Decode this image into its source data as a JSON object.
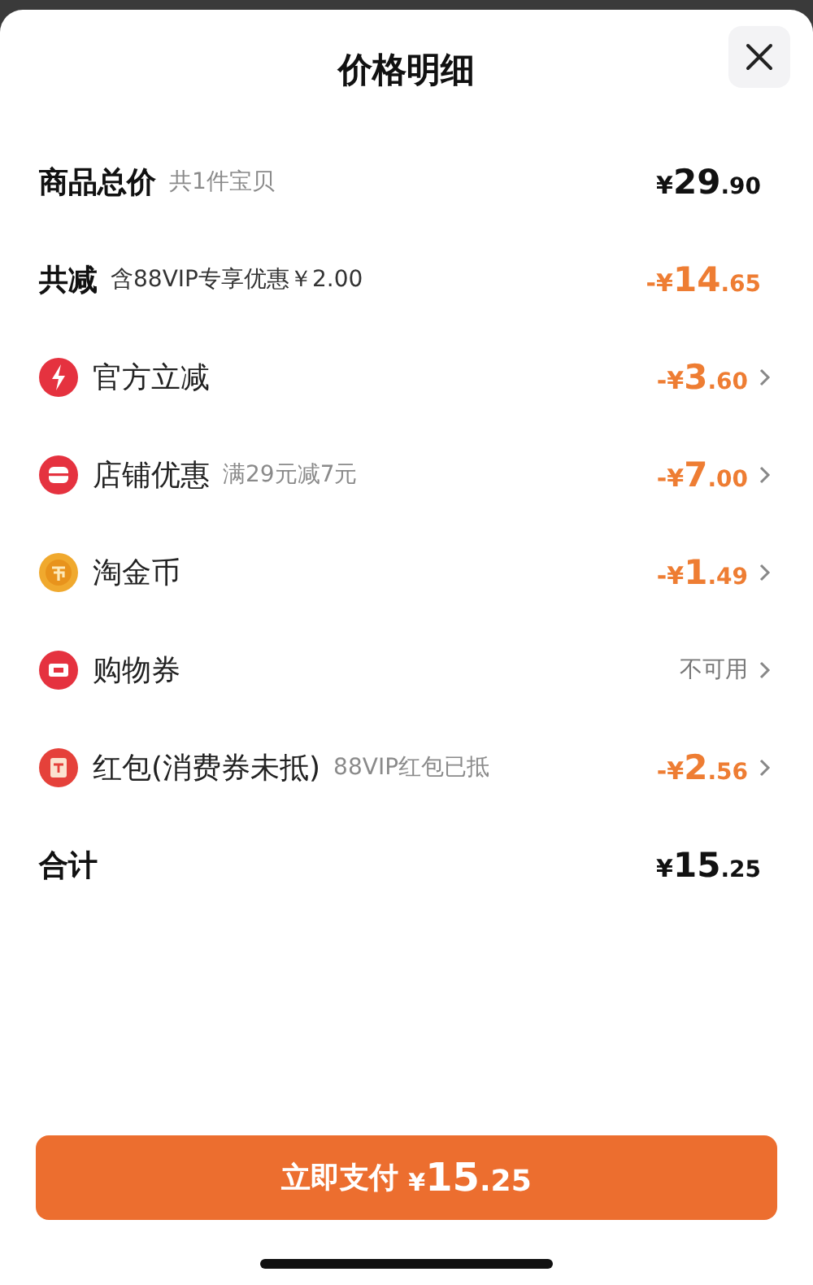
{
  "title": "价格明细",
  "rows": [
    {
      "kind": "summary",
      "label": "商品总价",
      "note": "共1件宝贝",
      "amount": {
        "prefix": "¥",
        "whole": "29",
        "decimal": ".90"
      },
      "discount": false,
      "chevron": false
    },
    {
      "kind": "summary",
      "label": "共减",
      "note": "含88VIP专享优惠￥2.00",
      "amount": {
        "prefix": "-¥",
        "whole": "14",
        "decimal": ".65"
      },
      "discount": true,
      "chevron": false
    },
    {
      "kind": "item",
      "label": "官方立减",
      "amount": {
        "prefix": "-¥",
        "whole": "3",
        "decimal": ".60"
      },
      "discount": true,
      "chevron": true
    },
    {
      "kind": "item",
      "label": "店铺优惠",
      "note": "满29元减7元",
      "amount": {
        "prefix": "-¥",
        "whole": "7",
        "decimal": ".00"
      },
      "discount": true,
      "chevron": true
    },
    {
      "kind": "item",
      "label": "淘金币",
      "amount": {
        "prefix": "-¥",
        "whole": "1",
        "decimal": ".49"
      },
      "discount": true,
      "chevron": true
    },
    {
      "kind": "item",
      "label": "购物券",
      "status": "不可用",
      "chevron": true
    },
    {
      "kind": "item",
      "label": "红包(消费券未抵)",
      "note": "88VIP红包已抵",
      "amount": {
        "prefix": "-¥",
        "whole": "2",
        "decimal": ".56"
      },
      "discount": true,
      "chevron": true
    },
    {
      "kind": "summary",
      "label": "合计",
      "amount": {
        "prefix": "¥",
        "whole": "15",
        "decimal": ".25"
      },
      "discount": false,
      "chevron": false
    }
  ],
  "pay_button": {
    "label": "立即支付",
    "amount": {
      "prefix": "¥",
      "whole": "15",
      "decimal": ".25"
    }
  }
}
